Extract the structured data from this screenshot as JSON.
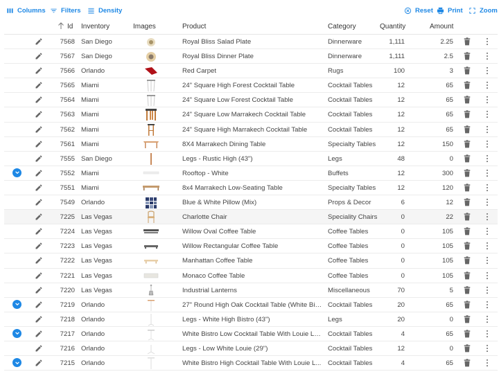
{
  "toolbar": {
    "columns_label": "Columns",
    "filters_label": "Filters",
    "density_label": "Density",
    "reset_label": "Reset",
    "print_label": "Print",
    "zoom_label": "Zoom",
    "accent_color": "#1e88e5"
  },
  "columns": {
    "id": "Id",
    "inventory": "Inventory",
    "images": "Images",
    "product": "Product",
    "category": "Category",
    "quantity": "Quantity",
    "amount": "Amount",
    "sort": "ascending"
  },
  "rows": [
    {
      "expandable": false,
      "id": "7568",
      "inventory": "San Diego",
      "image": "plate-small",
      "product": "Royal Bliss Salad Plate",
      "category": "Dinnerware",
      "quantity": "1,111",
      "amount": "2.25"
    },
    {
      "expandable": false,
      "id": "7567",
      "inventory": "San Diego",
      "image": "plate-large",
      "product": "Royal Bliss Dinner Plate",
      "category": "Dinnerware",
      "quantity": "1,111",
      "amount": "2.5"
    },
    {
      "expandable": false,
      "id": "7566",
      "inventory": "Orlando",
      "image": "red-carpet",
      "product": "Red Carpet",
      "category": "Rugs",
      "quantity": "100",
      "amount": "3"
    },
    {
      "expandable": false,
      "id": "7565",
      "inventory": "Miami",
      "image": "white-table-high",
      "product": "24\" Square High Forest Cocktail Table",
      "category": "Cocktail Tables",
      "quantity": "12",
      "amount": "65"
    },
    {
      "expandable": false,
      "id": "7564",
      "inventory": "Miami",
      "image": "white-table-low",
      "product": "24\" Square Low Forest Cocktail Table",
      "category": "Cocktail Tables",
      "quantity": "12",
      "amount": "65"
    },
    {
      "expandable": false,
      "id": "7563",
      "inventory": "Miami",
      "image": "wood-table-low",
      "product": "24\" Square Low Marrakech Cocktail Table",
      "category": "Cocktail Tables",
      "quantity": "12",
      "amount": "65"
    },
    {
      "expandable": false,
      "id": "7562",
      "inventory": "Miami",
      "image": "wood-table-high",
      "product": "24\" Square High Marrakech Cocktail Table",
      "category": "Cocktail Tables",
      "quantity": "12",
      "amount": "65"
    },
    {
      "expandable": false,
      "id": "7561",
      "inventory": "Miami",
      "image": "dining-table",
      "product": "8X4 Marrakech Dining Table",
      "category": "Specialty Tables",
      "quantity": "12",
      "amount": "150"
    },
    {
      "expandable": false,
      "id": "7555",
      "inventory": "San Diego",
      "image": "wood-leg",
      "product": "Legs - Rustic High (43\")",
      "category": "Legs",
      "quantity": "48",
      "amount": "0"
    },
    {
      "expandable": true,
      "id": "7552",
      "inventory": "Miami",
      "image": "white-buffet",
      "product": "Rooftop - White",
      "category": "Buffets",
      "quantity": "12",
      "amount": "300"
    },
    {
      "expandable": false,
      "id": "7551",
      "inventory": "Miami",
      "image": "low-table",
      "product": "8x4 Marrakech Low-Seating Table",
      "category": "Specialty Tables",
      "quantity": "12",
      "amount": "120"
    },
    {
      "expandable": false,
      "id": "7549",
      "inventory": "Orlando",
      "image": "pillows",
      "product": "Blue & White Pillow (Mix)",
      "category": "Props & Decor",
      "quantity": "6",
      "amount": "12"
    },
    {
      "expandable": false,
      "id": "7225",
      "inventory": "Las Vegas",
      "image": "chair",
      "product": "Charlotte Chair",
      "category": "Speciality Chairs",
      "quantity": "0",
      "amount": "22",
      "highlight": true
    },
    {
      "expandable": false,
      "id": "7224",
      "inventory": "Las Vegas",
      "image": "coffee-dark",
      "product": "Willow Oval Coffee Table",
      "category": "Coffee Tables",
      "quantity": "0",
      "amount": "105"
    },
    {
      "expandable": false,
      "id": "7223",
      "inventory": "Las Vegas",
      "image": "coffee-grey",
      "product": "Willow Rectangular Coffee Table",
      "category": "Coffee Tables",
      "quantity": "0",
      "amount": "105"
    },
    {
      "expandable": false,
      "id": "7222",
      "inventory": "Las Vegas",
      "image": "coffee-light",
      "product": "Manhattan Coffee Table",
      "category": "Coffee Tables",
      "quantity": "0",
      "amount": "105"
    },
    {
      "expandable": false,
      "id": "7221",
      "inventory": "Las Vegas",
      "image": "coffee-white",
      "product": "Monaco Coffee Table",
      "category": "Coffee Tables",
      "quantity": "0",
      "amount": "105"
    },
    {
      "expandable": false,
      "id": "7220",
      "inventory": "Las Vegas",
      "image": "lantern",
      "product": "Industrial Lanterns",
      "category": "Miscellaneous",
      "quantity": "70",
      "amount": "5"
    },
    {
      "expandable": true,
      "id": "7219",
      "inventory": "Orlando",
      "image": "bistro-oak",
      "product": "27\" Round High Oak Cocktail Table (White Bis...",
      "category": "Cocktail Tables",
      "quantity": "20",
      "amount": "65"
    },
    {
      "expandable": false,
      "id": "7218",
      "inventory": "Orlando",
      "image": "white-leg",
      "product": "Legs - White High Bistro (43\")",
      "category": "Legs",
      "quantity": "20",
      "amount": "0"
    },
    {
      "expandable": true,
      "id": "7217",
      "inventory": "Orlando",
      "image": "bistro-white-low",
      "product": "White Bistro Low Cocktail Table With Louie Le...",
      "category": "Cocktail Tables",
      "quantity": "4",
      "amount": "65"
    },
    {
      "expandable": false,
      "id": "7216",
      "inventory": "Orlando",
      "image": "louie-leg",
      "product": "Legs - Low White Louie (29\")",
      "category": "Cocktail Tables",
      "quantity": "12",
      "amount": "0"
    },
    {
      "expandable": true,
      "id": "7215",
      "inventory": "Orlando",
      "image": "bistro-white-high",
      "product": "White Bistro High Cocktail Table With Louie L...",
      "category": "Cocktail Tables",
      "quantity": "4",
      "amount": "65"
    }
  ]
}
